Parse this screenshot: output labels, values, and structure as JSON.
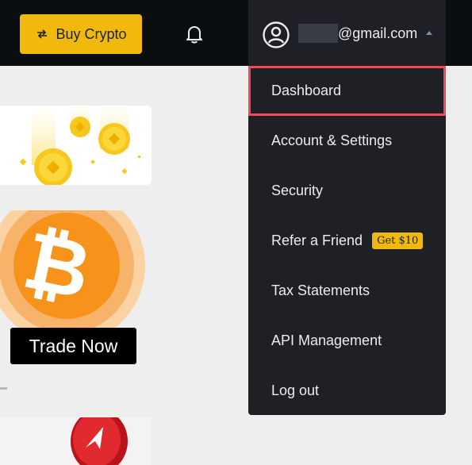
{
  "header": {
    "buy_crypto_label": "Buy Crypto",
    "email_suffix": "@gmail.com"
  },
  "promo": {
    "trade_now_label": "Trade Now"
  },
  "account_menu": {
    "items": [
      {
        "label": "Dashboard",
        "active": true
      },
      {
        "label": "Account & Settings"
      },
      {
        "label": "Security"
      },
      {
        "label": "Refer a Friend",
        "badge": "Get $10"
      },
      {
        "label": "Tax Statements"
      },
      {
        "label": "API Management"
      },
      {
        "label": "Log out"
      }
    ]
  },
  "colors": {
    "brand_yellow": "#f0b90b",
    "topbar_bg": "#0b0e11",
    "menu_bg": "#1e2026",
    "highlight_border": "#f6465d"
  },
  "icons": [
    "swap-arrows-icon",
    "bell-icon",
    "user-avatar-icon",
    "caret-up-icon",
    "bitcoin-icon"
  ]
}
